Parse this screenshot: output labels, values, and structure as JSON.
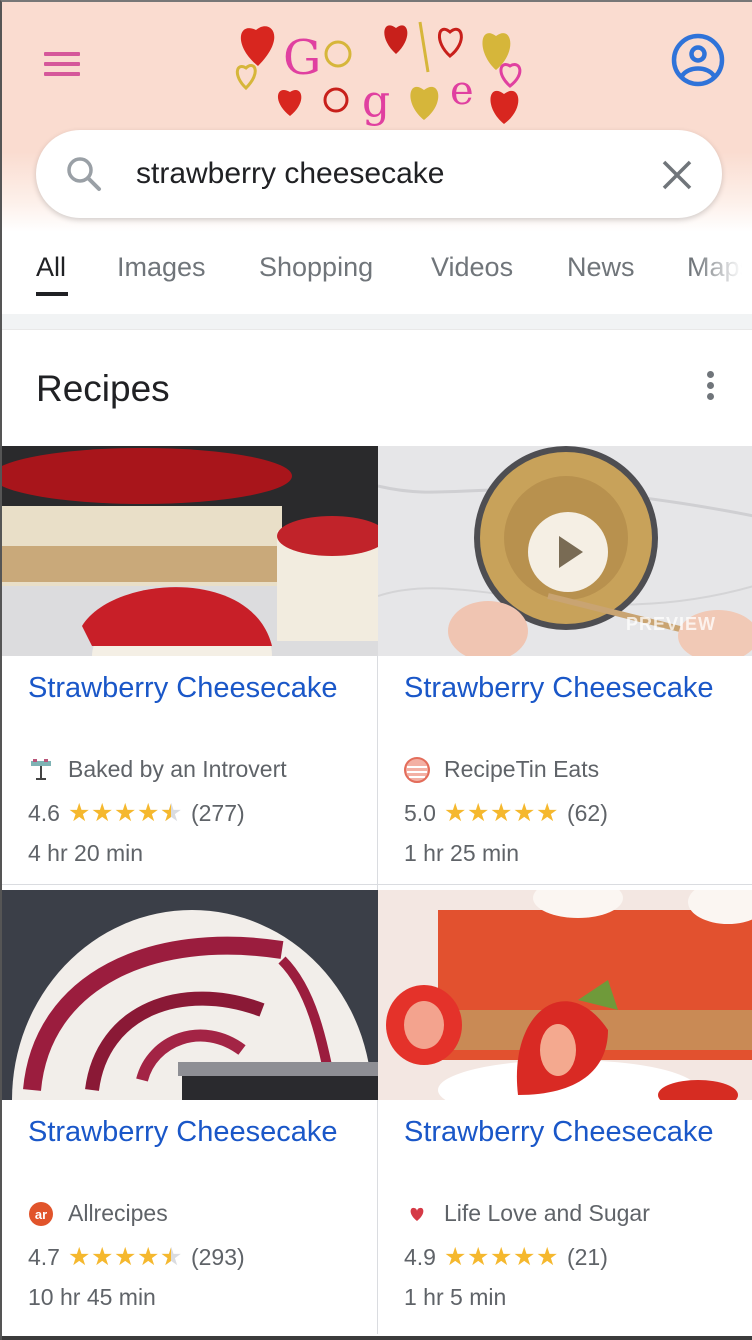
{
  "header": {
    "menu_icon": "hamburger-menu-icon",
    "logo": "google-valentines-doodle",
    "account_icon": "account-circle-icon",
    "colors": {
      "background": "#fadcd0",
      "menu": "#d5589a",
      "account": "#2f73d9"
    }
  },
  "search": {
    "query": "strawberry cheesecake",
    "search_icon": "search-icon",
    "clear_icon": "close-icon"
  },
  "tabs": [
    {
      "label": "All",
      "active": true
    },
    {
      "label": "Images",
      "active": false
    },
    {
      "label": "Shopping",
      "active": false
    },
    {
      "label": "Videos",
      "active": false
    },
    {
      "label": "News",
      "active": false
    },
    {
      "label": "Maps",
      "active": false
    }
  ],
  "recipes": {
    "title": "Recipes",
    "more_icon": "more-vert-icon",
    "items": [
      {
        "title": "Strawberry Cheesecake",
        "source": "Baked by an Introvert",
        "source_icon": "cake-stand-icon",
        "rating": "4.6",
        "rating_value": 4.6,
        "reviews": "(277)",
        "time": "4 hr 20 min",
        "video": false
      },
      {
        "title": "Strawberry Cheesecake",
        "source": "RecipeTin Eats",
        "source_icon": "recipetin-logo-icon",
        "rating": "5.0",
        "rating_value": 5.0,
        "reviews": "(62)",
        "time": "1 hr 25 min",
        "video": true,
        "preview_label": "PREVIEW"
      },
      {
        "title": "Strawberry Cheesecake",
        "source": "Allrecipes",
        "source_icon": "allrecipes-logo-icon",
        "source_logo_text": "ar",
        "rating": "4.7",
        "rating_value": 4.7,
        "reviews": "(293)",
        "time": "10 hr 45 min",
        "video": false
      },
      {
        "title": "Strawberry Cheesecake",
        "source": "Life Love and Sugar",
        "source_icon": "heart-icon",
        "rating": "4.9",
        "rating_value": 4.9,
        "reviews": "(21)",
        "time": "1 hr 5 min",
        "video": false
      }
    ]
  },
  "colors": {
    "link": "#1a57c8",
    "star": "#f5b82e",
    "muted_text": "#5f6368"
  }
}
